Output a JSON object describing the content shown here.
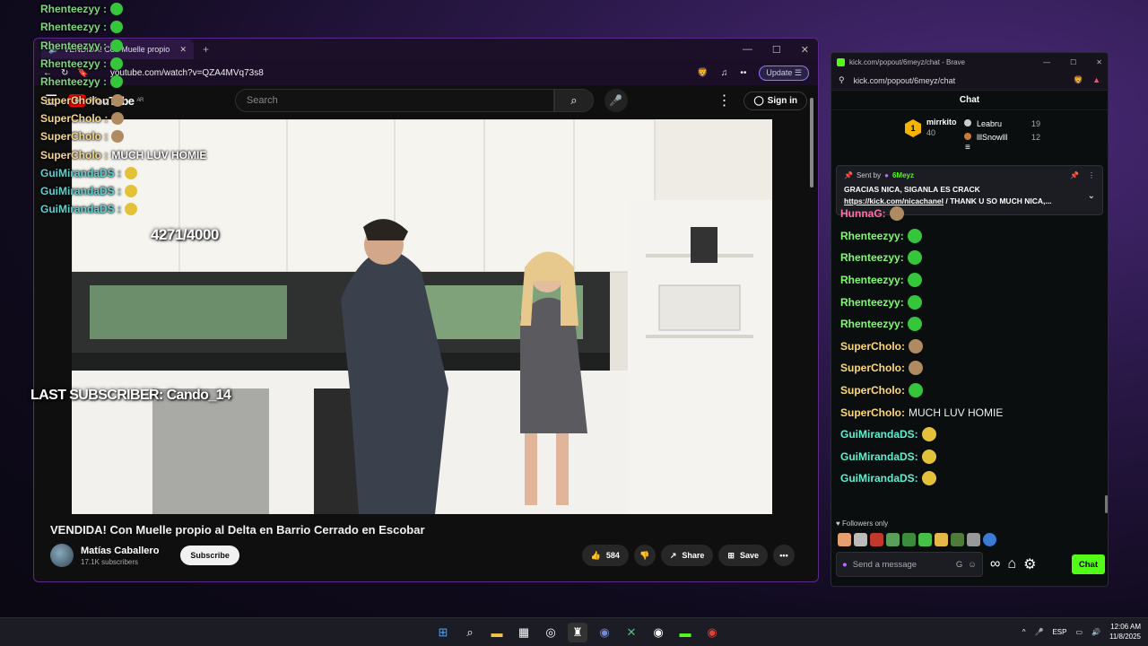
{
  "overlay": {
    "chat_lines": [
      {
        "user": "Rhenteezyy :",
        "text": "",
        "color": "#7dd87d",
        "emote": "green"
      },
      {
        "user": "Rhenteezyy :",
        "text": "",
        "color": "#7dd87d",
        "emote": "green"
      },
      {
        "user": "Rhenteezyy :",
        "text": "",
        "color": "#7dd87d",
        "emote": "green"
      },
      {
        "user": "Rhenteezyy :",
        "text": "",
        "color": "#7dd87d",
        "emote": "green"
      },
      {
        "user": "Rhenteezyy :",
        "text": "",
        "color": "#7dd87d",
        "emote": "green"
      },
      {
        "user": "SuperCholo :",
        "text": "",
        "color": "#f4d68a",
        "emote": "face"
      },
      {
        "user": "SuperCholo :",
        "text": "",
        "color": "#f4d68a",
        "emote": "face"
      },
      {
        "user": "SuperCholo :",
        "text": "",
        "color": "#f4d68a",
        "emote": "face"
      },
      {
        "user": "SuperCholo :",
        "text": "MUCH LUV HOMIE",
        "color": "#f4d68a",
        "emote": ""
      },
      {
        "user": "GuiMirandaDS :",
        "text": "",
        "color": "#5ed1d1",
        "emote": "yellow"
      },
      {
        "user": "GuiMirandaDS :",
        "text": "",
        "color": "#5ed1d1",
        "emote": "yellow"
      },
      {
        "user": "GuiMirandaDS :",
        "text": "",
        "color": "#5ed1d1",
        "emote": "yellow"
      }
    ],
    "counter": "4271/4000",
    "last_subscriber": "LAST SUBSCRIBER: Cando_14"
  },
  "youtube": {
    "tab_title": "VENDIDA! Con Muelle propio",
    "url": "youtube.com/watch?v=QZA4MVq73s8",
    "update_label": "Update",
    "logo_text": "YouTube",
    "logo_region": "AR",
    "search_placeholder": "Search",
    "signin_label": "Sign in",
    "video_title": "VENDIDA! Con Muelle propio al Delta en Barrio Cerrado en Escobar",
    "channel_name": "Matías Caballero",
    "channel_subs": "17.1K subscribers",
    "subscribe_label": "Subscribe",
    "likes": "584",
    "share_label": "Share",
    "save_label": "Save"
  },
  "kick": {
    "window_title": "kick.com/popout/6meyz/chat - Brave",
    "url": "kick.com/popout/6meyz/chat",
    "chat_header": "Chat",
    "leaderboard": {
      "first": {
        "rank": "1",
        "name": "mirrkito",
        "points": "40"
      },
      "others": [
        {
          "name": "Leabru",
          "points": "19"
        },
        {
          "name": "lllSnowlll",
          "points": "12"
        }
      ]
    },
    "pinned": {
      "sent_by": "Sent by",
      "sender": "6Meyz",
      "message": "GRACIAS NICA, SIGANLA ES CRACK",
      "link": "https://kick.com/nicachanel",
      "message2": " / THANK U SO MUCH NICA,..."
    },
    "messages": [
      {
        "user": "HunnaG:",
        "text": "",
        "color": "#ff6fa8",
        "emote": "face"
      },
      {
        "user": "Rhenteezyy:",
        "text": "",
        "color": "#7dfc6e",
        "emote": "green"
      },
      {
        "user": "Rhenteezyy:",
        "text": "",
        "color": "#7dfc6e",
        "emote": "green"
      },
      {
        "user": "Rhenteezyy:",
        "text": "",
        "color": "#7dfc6e",
        "emote": "green"
      },
      {
        "user": "Rhenteezyy:",
        "text": "",
        "color": "#7dfc6e",
        "emote": "green"
      },
      {
        "user": "Rhenteezyy:",
        "text": "",
        "color": "#7dfc6e",
        "emote": "green"
      },
      {
        "user": "SuperCholo:",
        "text": "",
        "color": "#ffd978",
        "emote": "face"
      },
      {
        "user": "SuperCholo:",
        "text": "",
        "color": "#ffd978",
        "emote": "face"
      },
      {
        "user": "SuperCholo:",
        "text": "",
        "color": "#ffd978",
        "emote": "green"
      },
      {
        "user": "SuperCholo:",
        "text": "MUCH LUV HOMIE",
        "color": "#ffd978",
        "emote": ""
      },
      {
        "user": "GuiMirandaDS:",
        "text": "",
        "color": "#5ef0d0",
        "emote": "yellow"
      },
      {
        "user": "GuiMirandaDS:",
        "text": "",
        "color": "#5ef0d0",
        "emote": "yellow"
      },
      {
        "user": "GuiMirandaDS:",
        "text": "",
        "color": "#5ef0d0",
        "emote": "yellow"
      }
    ],
    "followers_only": "Followers only",
    "input_placeholder": "Send a message",
    "chat_button": "Chat"
  },
  "taskbar": {
    "lang": "ESP",
    "time": "12:06 AM",
    "date": "11/8/2025"
  },
  "colors": {
    "kick_green": "#53fc18",
    "youtube_red": "#ff0000",
    "window_border": "#5b2b8c"
  }
}
